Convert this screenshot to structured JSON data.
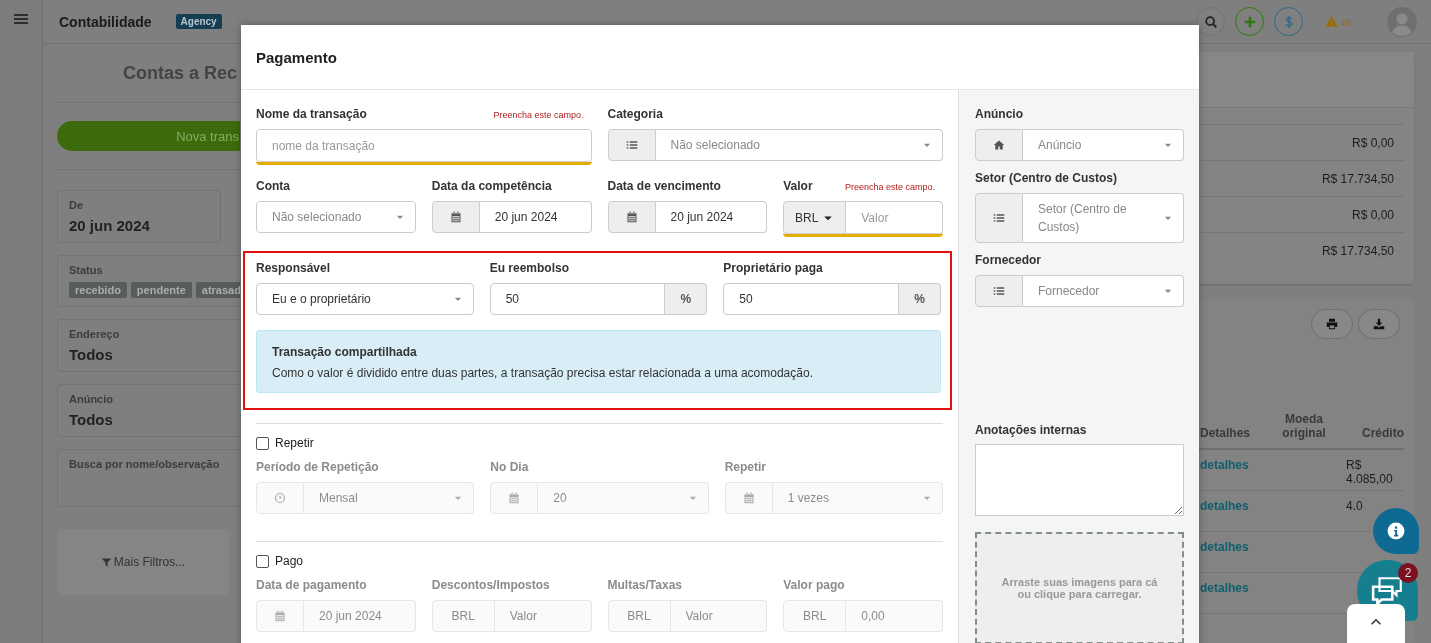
{
  "app": {
    "title": "Contabilidade",
    "badge": "Agency",
    "alerts": "48"
  },
  "page": {
    "heading": "Contas a Rec",
    "new_button": "Nova trans",
    "filters": [
      {
        "kind": "value",
        "label": "De",
        "value": "20 jun 2024"
      },
      {
        "kind": "tags",
        "label": "Status",
        "tags": [
          "recebido",
          "pendente",
          "atrasad"
        ]
      },
      {
        "kind": "value",
        "label": "Endereço",
        "value": "Todos"
      },
      {
        "kind": "value",
        "label": "Anúncio",
        "value": "Todos"
      },
      {
        "kind": "search",
        "label": "Busca por nome/observação"
      }
    ],
    "more_filters": "Mais Filtros..."
  },
  "summary": {
    "values": [
      "R$ 0,00",
      "R$ 17.734,50",
      "R$ 0,00",
      "R$ 17.734,50"
    ]
  },
  "table": {
    "columns": [
      "Detalhes",
      "Moeda original",
      "Crédito"
    ],
    "rows": [
      {
        "details": "detalhes",
        "credit": "R$ 4.085,00"
      },
      {
        "details": "detalhes",
        "credit": "4.0"
      },
      {
        "details": "detalhes"
      },
      {
        "details": "detalhes"
      }
    ]
  },
  "chat": {
    "badge": "2"
  },
  "modal": {
    "title": "Pagamento",
    "rows": [
      {
        "fields": [
          {
            "kind": "text",
            "label": "Nome da transação",
            "placeholder": "nome da transação",
            "error": "Preencha este campo."
          },
          {
            "kind": "list-select",
            "label": "Categoria",
            "placeholder": "Não selecionado"
          }
        ]
      },
      {
        "fields": [
          {
            "kind": "select",
            "label": "Conta",
            "placeholder": "Não selecionado"
          },
          {
            "kind": "date",
            "label": "Data da competência",
            "value": "20 jun 2024"
          },
          {
            "kind": "date",
            "label": "Data de vencimento",
            "value": "20 jun 2024"
          },
          {
            "kind": "currency",
            "label": "Valor",
            "currency": "BRL",
            "dropdown": true,
            "placeholder": "Valor",
            "error": "Preencha este campo."
          }
        ]
      }
    ],
    "shared": {
      "fields": [
        {
          "kind": "select",
          "label": "Responsável",
          "value": "Eu e o proprietário"
        },
        {
          "kind": "percent",
          "label": "Eu reembolso",
          "value": "50",
          "unit": "%"
        },
        {
          "kind": "percent",
          "label": "Proprietário paga",
          "value": "50",
          "unit": "%"
        }
      ],
      "alert": {
        "title": "Transação compartilhada",
        "text": "Como o valor é dividido entre duas partes, a transação precisa estar relacionada a uma acomodação."
      }
    },
    "sections": [
      {
        "label": "Repetir",
        "checked": false,
        "fields": [
          {
            "kind": "clock-select",
            "label": "Período de Repetição",
            "value": "Mensal"
          },
          {
            "kind": "calendar-select",
            "label": "No Dia",
            "value": "20"
          },
          {
            "kind": "calendar-select",
            "label": "Repetir",
            "value": "1 vezes"
          }
        ]
      },
      {
        "label": "Pago",
        "checked": false,
        "fields": [
          {
            "kind": "date",
            "label": "Data de pagamento",
            "value": "20 jun 2024"
          },
          {
            "kind": "currency",
            "label": "Descontos/Impostos",
            "currency": "BRL",
            "placeholder": "Valor"
          },
          {
            "kind": "currency",
            "label": "Multas/Taxas",
            "currency": "BRL",
            "placeholder": "Valor"
          },
          {
            "kind": "currency",
            "label": "Valor pago",
            "currency": "BRL",
            "value": "0,00"
          }
        ]
      }
    ],
    "side": {
      "fields": [
        {
          "kind": "home-select",
          "label": "Anúncio",
          "placeholder": "Anúncio"
        },
        {
          "kind": "list-select",
          "label": "Setor (Centro de Custos)",
          "placeholder": "Setor (Centro de Custos)"
        },
        {
          "kind": "list-select",
          "label": "Fornecedor",
          "placeholder": "Fornecedor"
        }
      ],
      "notes_label": "Anotações internas",
      "upload": "Arraste suas imagens para cá ou clique para carregar."
    }
  }
}
